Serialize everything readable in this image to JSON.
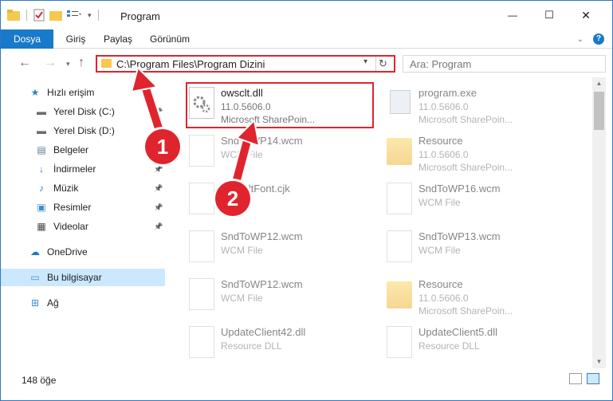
{
  "window": {
    "title": "Program",
    "controls": {
      "minimize": "—",
      "maximize": "☐",
      "close": "✕"
    }
  },
  "ribbon": {
    "tabs": [
      "Dosya",
      "Giriş",
      "Paylaş",
      "Görünüm"
    ]
  },
  "navigation": {
    "address_path": "C:\\Program Files\\Program Dizini",
    "search_placeholder": "Ara: Program"
  },
  "sidebar": {
    "items": [
      {
        "label": "Hızlı erişim",
        "icon": "star-icon",
        "pinned": false
      },
      {
        "label": "Yerel Disk (C:)",
        "icon": "drive-icon",
        "pinned": true
      },
      {
        "label": "Yerel Disk (D:)",
        "icon": "drive-icon",
        "pinned": false
      },
      {
        "label": "Belgeler",
        "icon": "documents-icon",
        "pinned": true
      },
      {
        "label": "İndirmeler",
        "icon": "download-icon",
        "pinned": true
      },
      {
        "label": "Müzik",
        "icon": "music-icon",
        "pinned": true
      },
      {
        "label": "Resimler",
        "icon": "pictures-icon",
        "pinned": true
      },
      {
        "label": "Videolar",
        "icon": "video-icon",
        "pinned": true
      },
      {
        "label": "OneDrive",
        "icon": "cloud-icon",
        "pinned": false
      },
      {
        "label": "Bu bilgisayar",
        "icon": "computer-icon",
        "pinned": false,
        "selected": true
      },
      {
        "label": "Ağ",
        "icon": "network-icon",
        "pinned": false
      }
    ]
  },
  "files": [
    {
      "name": "owsclt.dll",
      "line2": "11.0.5606.0",
      "line3": "Microsoft SharePoin...",
      "icon": "dll-gear-icon",
      "highlighted": true
    },
    {
      "name": "program.exe",
      "line2": "11.0.5606.0",
      "line3": "Microsoft SharePoin...",
      "icon": "exe-icon"
    },
    {
      "name": "SndToWP14.wcm",
      "line2": "WCM File",
      "line3": "",
      "icon": "file-icon"
    },
    {
      "name": "Resource",
      "line2": "11.0.5606.0",
      "line3": "Microsoft SharePoin...",
      "icon": "folder-icon"
    },
    {
      "name": "DefaultFont.cjk",
      "line2": "",
      "line3": "",
      "icon": "file-icon"
    },
    {
      "name": "SndToWP16.wcm",
      "line2": "WCM File",
      "line3": "",
      "icon": "file-icon"
    },
    {
      "name": "SndToWP12.wcm",
      "line2": "WCM File",
      "line3": "",
      "icon": "file-icon"
    },
    {
      "name": "SndToWP13.wcm",
      "line2": "WCM File",
      "line3": "",
      "icon": "file-icon"
    },
    {
      "name": "SndToWP12.wcm",
      "line2": "WCM File",
      "line3": "",
      "icon": "file-icon"
    },
    {
      "name": "Resource",
      "line2": "11.0.5606.0",
      "line3": "Microsoft SharePoin...",
      "icon": "folder-icon"
    },
    {
      "name": "UpdateClient42.dll",
      "line2": "Resource DLL",
      "line3": "",
      "icon": "file-icon"
    },
    {
      "name": "UpdateClient5.dll",
      "line2": "Resource DLL",
      "line3": "",
      "icon": "file-icon"
    }
  ],
  "status": {
    "item_count": "148 öğe"
  },
  "annotations": {
    "callout_1": "1",
    "callout_2": "2"
  },
  "colors": {
    "accent": "#1979ca",
    "annotation_red": "#e0242e",
    "selected_bg": "#cce8ff"
  }
}
